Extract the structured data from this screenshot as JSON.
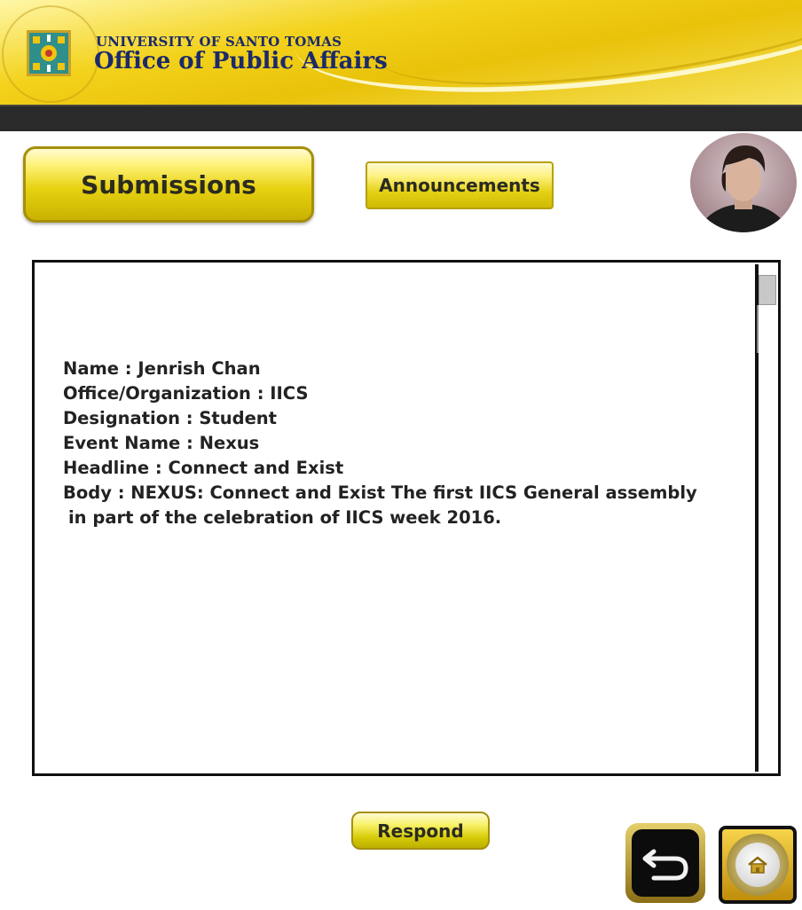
{
  "header": {
    "university": "UNIVERSITY OF SANTO TOMAS",
    "office": "Office of Public Affairs"
  },
  "nav": {
    "submissions_label": "Submissions",
    "announcements_label": "Announcements"
  },
  "submission": {
    "lines": [
      "Name : Jenrish Chan",
      "Office/Organization : IICS",
      "Designation : Student",
      "Event Name : Nexus",
      "Headline : Connect and Exist",
      "Body : NEXUS: Connect and Exist The first IICS General assembly"
    ],
    "body_continuation": "in part of the celebration of IICS week 2016."
  },
  "actions": {
    "respond_label": "Respond"
  },
  "icons": {
    "seal": "university-seal-icon",
    "back": "back-arrow-icon",
    "home": "home-icon"
  },
  "colors": {
    "brand_gold": "#e9c20a",
    "brand_navy": "#1b2a6b",
    "bar_dark": "#2a2a2a"
  }
}
